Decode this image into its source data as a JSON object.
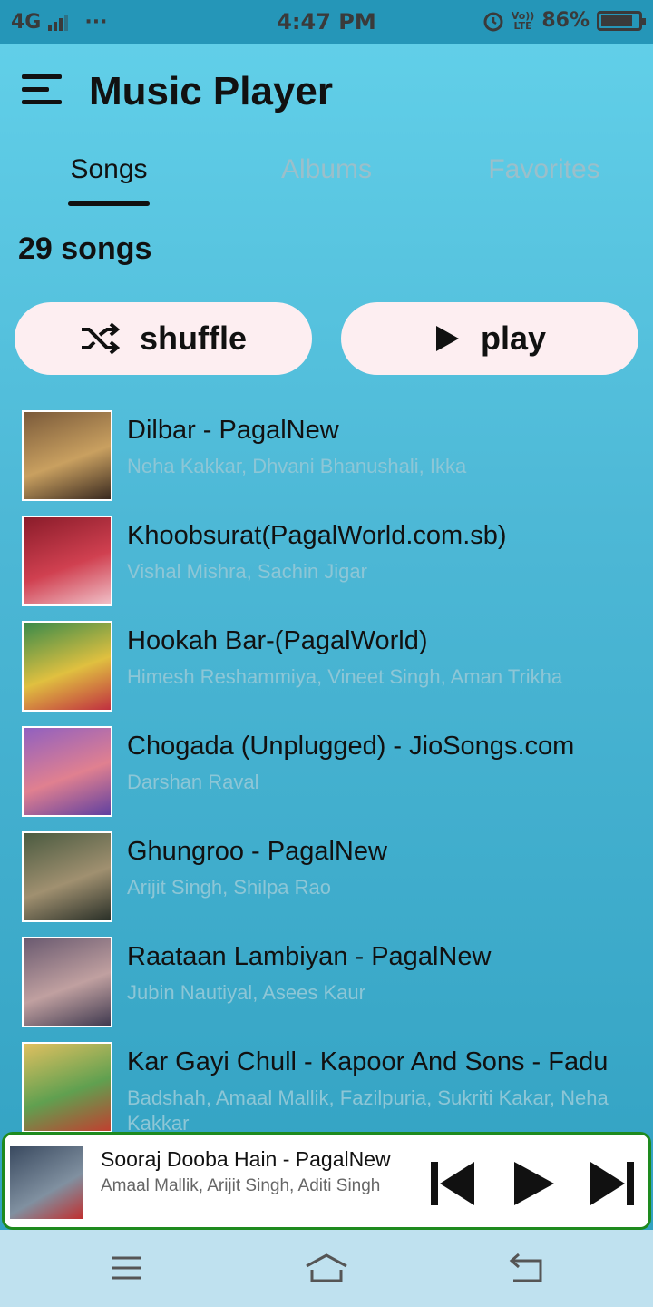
{
  "status_bar": {
    "network": "4G",
    "more": "···",
    "time": "4:47 PM",
    "volte_top": "Vo))",
    "volte_bottom": "LTE",
    "battery": "86%",
    "battery_level": 0.86
  },
  "app": {
    "title": "Music Player",
    "menu_icon": "hamburger-menu-icon"
  },
  "tabs": [
    {
      "label": "Songs",
      "active": true
    },
    {
      "label": "Albums",
      "active": false
    },
    {
      "label": "Favorites",
      "active": false
    }
  ],
  "song_count": "29 songs",
  "actions": {
    "shuffle_label": "shuffle",
    "shuffle_icon": "shuffle-icon",
    "play_label": "play",
    "play_icon": "play-icon"
  },
  "songs": [
    {
      "title": "Dilbar - PagalNew",
      "artist": "Neha Kakkar, Dhvani Bhanushali, Ikka",
      "art_colors": [
        "#7a5a3a",
        "#c9a060",
        "#3a2a20"
      ]
    },
    {
      "title": "Khoobsurat(PagalWorld.com.sb)",
      "artist": "Vishal Mishra, Sachin Jigar",
      "art_colors": [
        "#8a1c2a",
        "#d04050",
        "#f0c0c8"
      ]
    },
    {
      "title": "Hookah Bar-(PagalWorld)",
      "artist": "Himesh Reshammiya, Vineet Singh, Aman Trikha",
      "art_colors": [
        "#3a8a4a",
        "#e0c040",
        "#c03040"
      ]
    },
    {
      "title": "Chogada (Unplugged) - JioSongs.com",
      "artist": "Darshan Raval",
      "art_colors": [
        "#9060c0",
        "#e08090",
        "#6040a0"
      ]
    },
    {
      "title": "Ghungroo - PagalNew",
      "artist": "Arijit Singh, Shilpa Rao",
      "art_colors": [
        "#4a5a40",
        "#a09070",
        "#2a3028"
      ]
    },
    {
      "title": "Raataan Lambiyan - PagalNew",
      "artist": "Jubin Nautiyal, Asees Kaur",
      "art_colors": [
        "#6a5a70",
        "#c0a0a0",
        "#403a50"
      ]
    },
    {
      "title": "Kar Gayi Chull - Kapoor And Sons - Fadu",
      "artist": "Badshah, Amaal Mallik, Fazilpuria, Sukriti Kakar, Neha Kakkar",
      "art_colors": [
        "#e0c060",
        "#60a050",
        "#c04030"
      ]
    }
  ],
  "now_playing": {
    "title": "Sooraj Dooba Hain - PagalNew",
    "artist": "Amaal Mallik, Arijit Singh, Aditi Singh",
    "art_colors": [
      "#3a4a60",
      "#8090a0",
      "#c03030"
    ],
    "controls": [
      "skip-previous-icon",
      "play-icon",
      "skip-next-icon"
    ]
  },
  "nav": {
    "icons": [
      "recent-apps-icon",
      "home-icon",
      "back-icon"
    ]
  },
  "colors": {
    "accent_bg": "#4db8d6",
    "pill_bg": "#fdeef1",
    "mini_player_border": "#1e8a1e",
    "tab_inactive": "#9bbfca",
    "artist_text": "#8dc6d6"
  }
}
